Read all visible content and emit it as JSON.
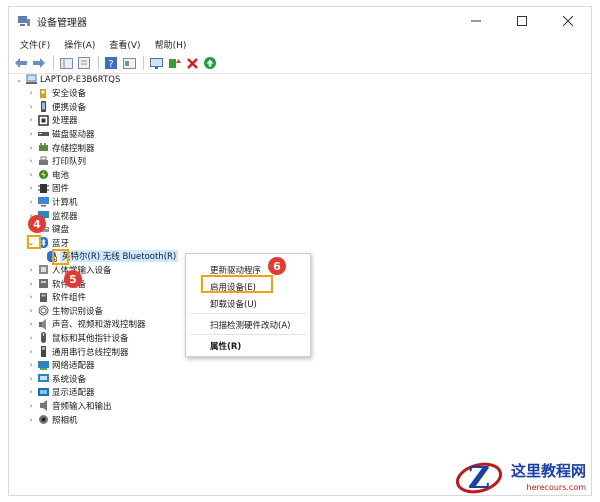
{
  "window": {
    "title": "设备管理器"
  },
  "menubar": [
    "文件(F)",
    "操作(A)",
    "查看(V)",
    "帮助(H)"
  ],
  "tree": {
    "root": "LAPTOP-E3B6RTQS",
    "items": [
      {
        "label": "安全设备",
        "icon": "security-key-icon"
      },
      {
        "label": "便携设备",
        "icon": "portable-device-icon"
      },
      {
        "label": "处理器",
        "icon": "processor-icon"
      },
      {
        "label": "磁盘驱动器",
        "icon": "disk-drive-icon"
      },
      {
        "label": "存储控制器",
        "icon": "storage-controller-icon"
      },
      {
        "label": "打印队列",
        "icon": "printer-icon"
      },
      {
        "label": "电池",
        "icon": "battery-icon"
      },
      {
        "label": "固件",
        "icon": "firmware-icon"
      },
      {
        "label": "计算机",
        "icon": "computer-icon"
      },
      {
        "label": "监视器",
        "icon": "monitor-icon"
      },
      {
        "label": "键盘",
        "icon": "keyboard-icon"
      },
      {
        "label": "蓝牙",
        "icon": "bluetooth-icon",
        "expanded": true
      },
      {
        "label": "英特尔(R) 无线 Bluetooth(R)",
        "icon": "bluetooth-device-disabled-icon",
        "child": true,
        "selected": true
      },
      {
        "label": "人体学输入设备",
        "icon": "hid-icon"
      },
      {
        "label": "软件设备",
        "icon": "software-device-icon"
      },
      {
        "label": "软件组件",
        "icon": "software-component-icon"
      },
      {
        "label": "生物识别设备",
        "icon": "fingerprint-icon"
      },
      {
        "label": "声音、视频和游戏控制器",
        "icon": "sound-icon"
      },
      {
        "label": "鼠标和其他指针设备",
        "icon": "mouse-icon"
      },
      {
        "label": "通用串行总线控制器",
        "icon": "usb-icon"
      },
      {
        "label": "网络适配器",
        "icon": "network-adapter-icon"
      },
      {
        "label": "系统设备",
        "icon": "system-device-icon"
      },
      {
        "label": "显示适配器",
        "icon": "display-adapter-icon"
      },
      {
        "label": "音频输入和输出",
        "icon": "audio-io-icon"
      },
      {
        "label": "照相机",
        "icon": "camera-icon"
      }
    ]
  },
  "context_menu": {
    "update_driver": "更新驱动程序",
    "enable_device": "启用设备(E)",
    "uninstall_device": "卸载设备(U)",
    "scan_hardware": "扫描检测硬件改动(A)",
    "properties": "属性(R)"
  },
  "annotations": {
    "step4": "4",
    "step5": "5",
    "step6": "6"
  },
  "watermark": {
    "cn": "这里教程网",
    "en": "herecours.com"
  },
  "colors": {
    "badge": "#e53935",
    "highlight_box": "#f4a300",
    "selection": "#cde8ff"
  }
}
